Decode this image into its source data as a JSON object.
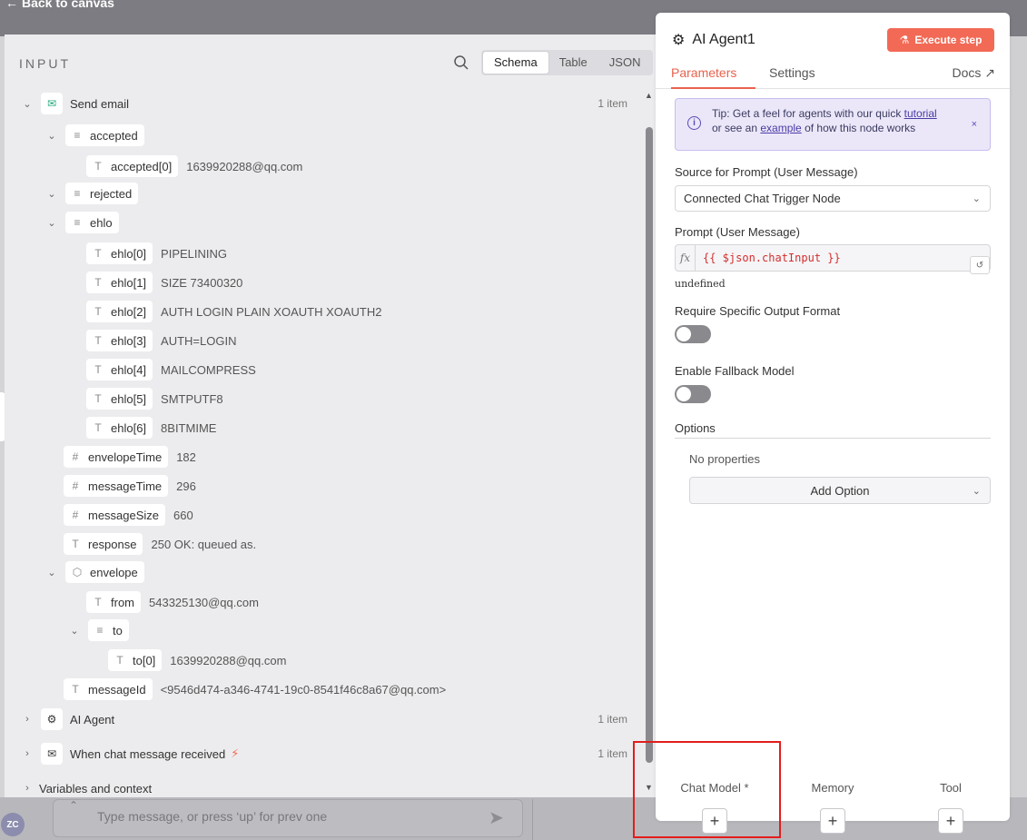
{
  "header": {
    "back_label": "Back to canvas"
  },
  "chat": {
    "placeholder": "Type message, or press ‘up’ for prev one",
    "avatar_initials": "ZC"
  },
  "input_panel": {
    "title": "INPUT",
    "view_tabs": [
      "Schema",
      "Table",
      "JSON"
    ],
    "active_view": "Schema",
    "nodes": [
      {
        "name": "Send email",
        "count": "1 item"
      },
      {
        "name": "AI Agent",
        "count": "1 item"
      },
      {
        "name": "When chat message received",
        "count": "1 item"
      },
      {
        "name": "Variables and context"
      }
    ],
    "fields": {
      "accepted": "accepted",
      "accepted_0": {
        "key": "accepted[0]",
        "value": "1639920288@qq.com"
      },
      "rejected": "rejected",
      "ehlo": "ehlo",
      "ehlo_items": [
        {
          "key": "ehlo[0]",
          "value": "PIPELINING"
        },
        {
          "key": "ehlo[1]",
          "value": "SIZE 73400320"
        },
        {
          "key": "ehlo[2]",
          "value": "AUTH LOGIN PLAIN XOAUTH XOAUTH2"
        },
        {
          "key": "ehlo[3]",
          "value": "AUTH=LOGIN"
        },
        {
          "key": "ehlo[4]",
          "value": "MAILCOMPRESS"
        },
        {
          "key": "ehlo[5]",
          "value": "SMTPUTF8"
        },
        {
          "key": "ehlo[6]",
          "value": "8BITMIME"
        }
      ],
      "envelopeTime": {
        "key": "envelopeTime",
        "value": "182"
      },
      "messageTime": {
        "key": "messageTime",
        "value": "296"
      },
      "messageSize": {
        "key": "messageSize",
        "value": "660"
      },
      "response": {
        "key": "response",
        "value": "250 OK: queued as."
      },
      "envelope": "envelope",
      "from": {
        "key": "from",
        "value": "543325130@qq.com"
      },
      "to": "to",
      "to_0": {
        "key": "to[0]",
        "value": "1639920288@qq.com"
      },
      "messageId": {
        "key": "messageId",
        "value": "<9546d474-a346-4741-19c0-8541f46c8a67@qq.com>"
      }
    }
  },
  "node_panel": {
    "title": "AI Agent1",
    "execute_label": "Execute step",
    "tabs": [
      "Parameters",
      "Settings"
    ],
    "docs_label": "Docs",
    "tip": {
      "prefix": "Tip: Get a feel for agents with our quick ",
      "link1": "tutorial",
      "middle": "or see an ",
      "link2": "example",
      "suffix": " of how this node works",
      "close": "×"
    },
    "source_label": "Source for Prompt (User Message)",
    "source_value": "Connected Chat Trigger Node",
    "prompt_label": "Prompt (User Message)",
    "prompt_value": "{{ $json.chatInput }}",
    "prompt_result": "undefined",
    "require_format_label": "Require Specific Output Format",
    "fallback_label": "Enable Fallback Model",
    "options_label": "Options",
    "no_properties": "No properties",
    "add_option": "Add Option",
    "slots": [
      "Chat Model *",
      "Memory",
      "Tool"
    ]
  },
  "colors": {
    "accent": "#e8624d",
    "execute": "#f26a55",
    "tip_bg": "#ebe7f9",
    "highlight": "#e21d1d"
  }
}
